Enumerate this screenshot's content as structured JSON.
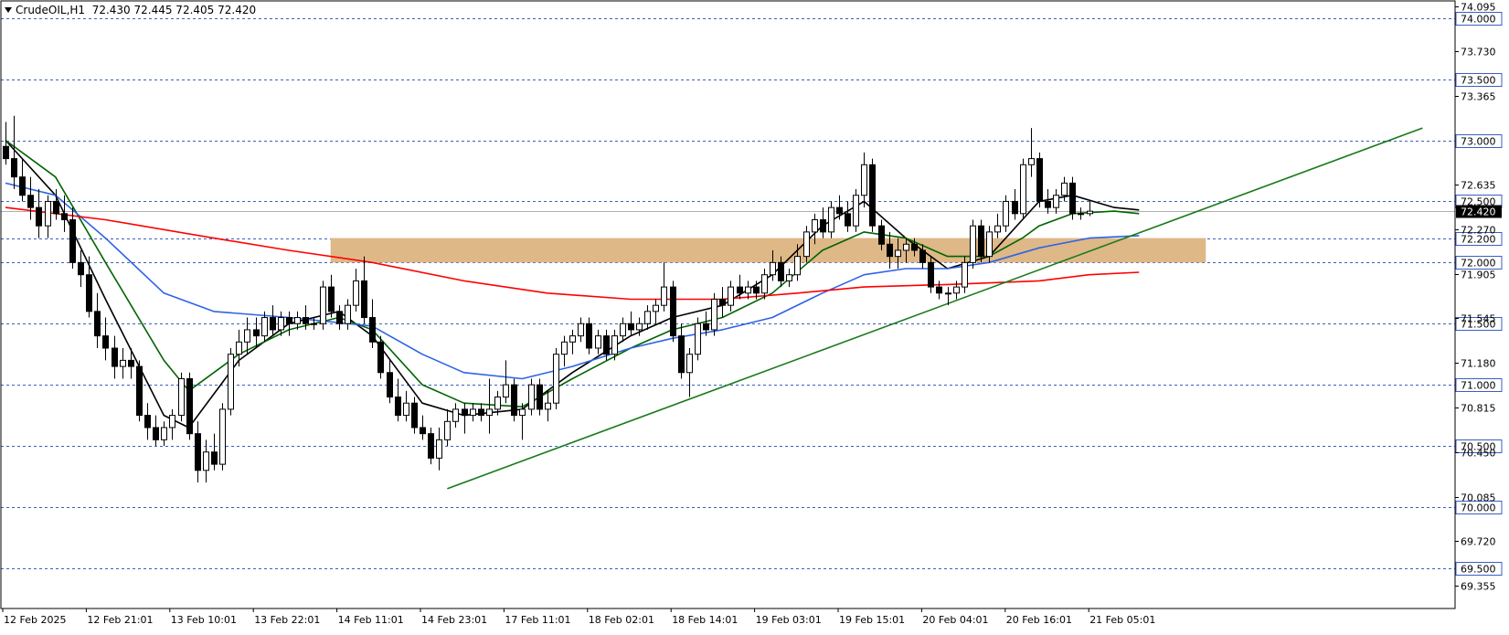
{
  "header": {
    "symbol_timeframe": "CrudeOIL,H1",
    "ohlc": "72.430 72.445 72.405 72.420"
  },
  "colors": {
    "grid_line": "#3a5fbf",
    "candle_bull": "#ffffff",
    "candle_bear": "#000000",
    "ma_black": "#000000",
    "ma_green": "#006400",
    "ma_blue": "#2e62e6",
    "ma_red": "#ff0000",
    "trendline": "#1a7a1a",
    "zone_fill": "#deb887",
    "current_price_bg": "#000000"
  },
  "chart_data": {
    "type": "candlestick",
    "symbol": "CrudeOIL",
    "timeframe": "H1",
    "ylim": [
      69.17,
      74.14
    ],
    "y_tick_labels": [
      "74.095",
      "73.730",
      "73.365",
      "72.635",
      "72.270",
      "71.905",
      "71.545",
      "71.180",
      "70.815",
      "70.450",
      "70.085",
      "69.720",
      "69.355"
    ],
    "level_lines": [
      "74.000",
      "73.500",
      "73.000",
      "72.500",
      "72.200",
      "72.000",
      "71.500",
      "71.000",
      "70.500",
      "70.000",
      "69.500"
    ],
    "current_price": "72.420",
    "x_labels": [
      "12 Feb 2025",
      "12 Feb 21:01",
      "13 Feb 10:01",
      "13 Feb 22:01",
      "14 Feb 11:01",
      "14 Feb 23:01",
      "17 Feb 11:01",
      "18 Feb 02:01",
      "18 Feb 14:01",
      "19 Feb 03:01",
      "19 Feb 15:01",
      "20 Feb 04:01",
      "20 Feb 16:01",
      "21 Feb 05:01"
    ],
    "bars": [
      [
        72.95,
        73.15,
        72.8,
        72.85
      ],
      [
        72.85,
        73.2,
        72.6,
        72.7
      ],
      [
        72.7,
        72.85,
        72.5,
        72.55
      ],
      [
        72.55,
        72.7,
        72.35,
        72.45
      ],
      [
        72.45,
        72.6,
        72.2,
        72.3
      ],
      [
        72.3,
        72.55,
        72.2,
        72.5
      ],
      [
        72.5,
        72.6,
        72.35,
        72.4
      ],
      [
        72.4,
        72.55,
        72.25,
        72.35
      ],
      [
        72.35,
        72.45,
        71.95,
        72.0
      ],
      [
        72.0,
        72.1,
        71.8,
        71.9
      ],
      [
        71.9,
        72.05,
        71.55,
        71.6
      ],
      [
        71.6,
        71.75,
        71.3,
        71.4
      ],
      [
        71.4,
        71.55,
        71.2,
        71.3
      ],
      [
        71.3,
        71.4,
        71.05,
        71.15
      ],
      [
        71.15,
        71.3,
        71.05,
        71.2
      ],
      [
        71.2,
        71.3,
        71.05,
        71.15
      ],
      [
        71.15,
        71.2,
        70.7,
        70.75
      ],
      [
        70.75,
        70.85,
        70.55,
        70.65
      ],
      [
        70.65,
        70.75,
        70.5,
        70.55
      ],
      [
        70.55,
        70.7,
        70.5,
        70.65
      ],
      [
        70.65,
        70.8,
        70.55,
        70.75
      ],
      [
        70.75,
        71.1,
        70.7,
        71.05
      ],
      [
        71.05,
        71.1,
        70.55,
        70.6
      ],
      [
        70.6,
        70.7,
        70.2,
        70.3
      ],
      [
        70.3,
        70.55,
        70.2,
        70.45
      ],
      [
        70.45,
        70.6,
        70.3,
        70.35
      ],
      [
        70.35,
        70.85,
        70.3,
        70.8
      ],
      [
        70.8,
        71.3,
        70.75,
        71.25
      ],
      [
        71.25,
        71.45,
        71.15,
        71.35
      ],
      [
        71.35,
        71.55,
        71.25,
        71.45
      ],
      [
        71.45,
        71.55,
        71.3,
        71.4
      ],
      [
        71.4,
        71.6,
        71.35,
        71.55
      ],
      [
        71.55,
        71.65,
        71.4,
        71.45
      ],
      [
        71.45,
        71.6,
        71.4,
        71.55
      ],
      [
        71.55,
        71.6,
        71.4,
        71.5
      ],
      [
        71.5,
        71.6,
        71.45,
        71.55
      ],
      [
        71.55,
        71.65,
        71.45,
        71.5
      ],
      [
        71.5,
        71.55,
        71.45,
        71.5
      ],
      [
        71.5,
        71.85,
        71.45,
        71.8
      ],
      [
        71.8,
        71.9,
        71.55,
        71.6
      ],
      [
        71.6,
        71.65,
        71.45,
        71.5
      ],
      [
        71.5,
        71.7,
        71.45,
        71.65
      ],
      [
        71.65,
        71.95,
        71.6,
        71.85
      ],
      [
        71.85,
        72.05,
        71.5,
        71.55
      ],
      [
        71.55,
        71.7,
        71.3,
        71.35
      ],
      [
        71.35,
        71.4,
        71.05,
        71.1
      ],
      [
        71.1,
        71.2,
        70.85,
        70.9
      ],
      [
        70.9,
        71.05,
        70.7,
        70.75
      ],
      [
        70.75,
        70.95,
        70.7,
        70.85
      ],
      [
        70.85,
        70.9,
        70.6,
        70.65
      ],
      [
        70.65,
        70.75,
        70.55,
        70.6
      ],
      [
        70.6,
        70.65,
        70.35,
        70.4
      ],
      [
        70.4,
        70.65,
        70.3,
        70.55
      ],
      [
        70.55,
        70.8,
        70.5,
        70.7
      ],
      [
        70.7,
        70.85,
        70.65,
        70.8
      ],
      [
        70.8,
        70.85,
        70.6,
        70.75
      ],
      [
        70.75,
        70.85,
        70.7,
        70.8
      ],
      [
        70.8,
        70.85,
        70.7,
        70.75
      ],
      [
        70.75,
        71.05,
        70.6,
        70.8
      ],
      [
        70.8,
        70.95,
        70.75,
        70.9
      ],
      [
        70.9,
        71.2,
        70.85,
        71.0
      ],
      [
        71.0,
        71.05,
        70.7,
        70.75
      ],
      [
        70.75,
        70.85,
        70.55,
        70.8
      ],
      [
        70.8,
        71.05,
        70.75,
        71.0
      ],
      [
        71.0,
        71.05,
        70.75,
        70.8
      ],
      [
        70.8,
        70.95,
        70.7,
        70.85
      ],
      [
        70.85,
        71.3,
        70.8,
        71.25
      ],
      [
        71.25,
        71.4,
        71.15,
        71.35
      ],
      [
        71.35,
        71.45,
        71.25,
        71.4
      ],
      [
        71.4,
        71.55,
        71.35,
        71.5
      ],
      [
        71.5,
        71.55,
        71.25,
        71.3
      ],
      [
        71.3,
        71.45,
        71.25,
        71.4
      ],
      [
        71.4,
        71.45,
        71.2,
        71.25
      ],
      [
        71.25,
        71.45,
        71.2,
        71.4
      ],
      [
        71.4,
        71.55,
        71.35,
        71.5
      ],
      [
        71.5,
        71.6,
        71.4,
        71.45
      ],
      [
        71.45,
        71.55,
        71.4,
        71.5
      ],
      [
        71.5,
        71.65,
        71.45,
        71.6
      ],
      [
        71.6,
        71.7,
        71.5,
        71.65
      ],
      [
        71.65,
        72.0,
        71.6,
        71.8
      ],
      [
        71.8,
        71.85,
        71.35,
        71.4
      ],
      [
        71.4,
        71.5,
        71.05,
        71.1
      ],
      [
        71.1,
        71.3,
        70.9,
        71.25
      ],
      [
        71.25,
        71.55,
        71.2,
        71.5
      ],
      [
        71.5,
        71.6,
        71.4,
        71.45
      ],
      [
        71.45,
        71.75,
        71.4,
        71.7
      ],
      [
        71.7,
        71.8,
        71.55,
        71.65
      ],
      [
        71.65,
        71.85,
        71.6,
        71.8
      ],
      [
        71.8,
        71.9,
        71.7,
        71.75
      ],
      [
        71.75,
        71.85,
        71.7,
        71.8
      ],
      [
        71.8,
        71.85,
        71.7,
        71.75
      ],
      [
        71.75,
        71.95,
        71.7,
        71.9
      ],
      [
        71.9,
        72.1,
        71.85,
        72.0
      ],
      [
        72.0,
        72.05,
        71.8,
        71.85
      ],
      [
        71.85,
        71.95,
        71.8,
        71.9
      ],
      [
        71.9,
        72.15,
        71.85,
        72.05
      ],
      [
        72.05,
        72.3,
        72.0,
        72.25
      ],
      [
        72.25,
        72.4,
        72.15,
        72.35
      ],
      [
        72.35,
        72.45,
        72.2,
        72.25
      ],
      [
        72.25,
        72.5,
        72.2,
        72.45
      ],
      [
        72.45,
        72.55,
        72.35,
        72.4
      ],
      [
        72.4,
        72.5,
        72.25,
        72.3
      ],
      [
        72.3,
        72.6,
        72.25,
        72.55
      ],
      [
        72.55,
        72.9,
        72.45,
        72.8
      ],
      [
        72.8,
        72.85,
        72.25,
        72.3
      ],
      [
        72.3,
        72.35,
        72.1,
        72.15
      ],
      [
        72.15,
        72.25,
        71.95,
        72.05
      ],
      [
        72.05,
        72.2,
        71.95,
        72.1
      ],
      [
        72.1,
        72.2,
        72.0,
        72.15
      ],
      [
        72.15,
        72.2,
        72.05,
        72.1
      ],
      [
        72.1,
        72.15,
        71.95,
        72.0
      ],
      [
        72.0,
        72.05,
        71.75,
        71.8
      ],
      [
        71.8,
        71.85,
        71.7,
        71.75
      ],
      [
        71.75,
        71.8,
        71.65,
        71.75
      ],
      [
        71.75,
        71.85,
        71.7,
        71.8
      ],
      [
        71.8,
        72.05,
        71.75,
        72.0
      ],
      [
        72.0,
        72.35,
        71.95,
        72.3
      ],
      [
        72.3,
        72.35,
        72.0,
        72.05
      ],
      [
        72.05,
        72.3,
        72.0,
        72.25
      ],
      [
        72.25,
        72.4,
        72.2,
        72.3
      ],
      [
        72.3,
        72.55,
        72.25,
        72.5
      ],
      [
        72.5,
        72.6,
        72.35,
        72.4
      ],
      [
        72.4,
        72.85,
        72.35,
        72.8
      ],
      [
        72.8,
        73.1,
        72.7,
        72.85
      ],
      [
        72.85,
        72.9,
        72.45,
        72.5
      ],
      [
        72.5,
        72.6,
        72.4,
        72.45
      ],
      [
        72.45,
        72.6,
        72.4,
        72.55
      ],
      [
        72.55,
        72.7,
        72.5,
        72.65
      ],
      [
        72.65,
        72.7,
        72.35,
        72.4
      ],
      [
        72.4,
        72.45,
        72.35,
        72.4
      ],
      [
        72.4,
        72.5,
        72.38,
        72.42
      ]
    ],
    "moving_averages": [
      {
        "color": "#000000",
        "points": [
          [
            0,
            73.0
          ],
          [
            6,
            72.55
          ],
          [
            12,
            71.7
          ],
          [
            19,
            70.75
          ],
          [
            22,
            70.65
          ],
          [
            28,
            71.2
          ],
          [
            34,
            71.5
          ],
          [
            40,
            71.6
          ],
          [
            44,
            71.4
          ],
          [
            50,
            70.85
          ],
          [
            55,
            70.75
          ],
          [
            62,
            70.8
          ],
          [
            68,
            71.1
          ],
          [
            75,
            71.4
          ],
          [
            80,
            71.55
          ],
          [
            86,
            71.65
          ],
          [
            92,
            71.9
          ],
          [
            98,
            72.3
          ],
          [
            103,
            72.5
          ],
          [
            108,
            72.2
          ],
          [
            113,
            71.95
          ],
          [
            118,
            72.05
          ],
          [
            122,
            72.35
          ],
          [
            124,
            72.5
          ],
          [
            128,
            72.55
          ],
          [
            133,
            72.45
          ],
          [
            136,
            72.43
          ]
        ]
      },
      {
        "color": "#006400",
        "points": [
          [
            0,
            73.0
          ],
          [
            6,
            72.7
          ],
          [
            12,
            72.0
          ],
          [
            19,
            71.2
          ],
          [
            22,
            70.95
          ],
          [
            28,
            71.25
          ],
          [
            34,
            71.45
          ],
          [
            40,
            71.55
          ],
          [
            44,
            71.45
          ],
          [
            50,
            71.0
          ],
          [
            55,
            70.85
          ],
          [
            62,
            70.82
          ],
          [
            68,
            71.05
          ],
          [
            75,
            71.3
          ],
          [
            80,
            71.45
          ],
          [
            86,
            71.55
          ],
          [
            92,
            71.75
          ],
          [
            98,
            72.1
          ],
          [
            103,
            72.25
          ],
          [
            108,
            72.2
          ],
          [
            113,
            72.05
          ],
          [
            118,
            72.05
          ],
          [
            122,
            72.2
          ],
          [
            124,
            72.3
          ],
          [
            128,
            72.4
          ],
          [
            133,
            72.42
          ],
          [
            136,
            72.4
          ]
        ]
      },
      {
        "color": "#2e62e6",
        "points": [
          [
            0,
            72.65
          ],
          [
            6,
            72.55
          ],
          [
            12,
            72.2
          ],
          [
            19,
            71.75
          ],
          [
            25,
            71.6
          ],
          [
            34,
            71.55
          ],
          [
            44,
            71.48
          ],
          [
            50,
            71.25
          ],
          [
            55,
            71.1
          ],
          [
            62,
            71.05
          ],
          [
            68,
            71.15
          ],
          [
            75,
            71.3
          ],
          [
            80,
            71.38
          ],
          [
            86,
            71.45
          ],
          [
            92,
            71.55
          ],
          [
            98,
            71.75
          ],
          [
            103,
            71.9
          ],
          [
            108,
            71.95
          ],
          [
            113,
            71.95
          ],
          [
            118,
            72.0
          ],
          [
            124,
            72.12
          ],
          [
            130,
            72.2
          ],
          [
            136,
            72.22
          ]
        ]
      },
      {
        "color": "#ff0000",
        "points": [
          [
            0,
            72.45
          ],
          [
            12,
            72.35
          ],
          [
            25,
            72.2
          ],
          [
            34,
            72.1
          ],
          [
            44,
            72.0
          ],
          [
            55,
            71.85
          ],
          [
            65,
            71.75
          ],
          [
            75,
            71.7
          ],
          [
            86,
            71.7
          ],
          [
            95,
            71.75
          ],
          [
            103,
            71.8
          ],
          [
            113,
            71.82
          ],
          [
            124,
            71.85
          ],
          [
            130,
            71.9
          ],
          [
            136,
            71.92
          ]
        ]
      }
    ],
    "trendline": {
      "from": [
        53,
        70.15
      ],
      "to": [
        170,
        73.1
      ]
    },
    "zone": {
      "from": 39,
      "to": 144,
      "y_top": 72.2,
      "y_bottom": 72.0
    }
  }
}
